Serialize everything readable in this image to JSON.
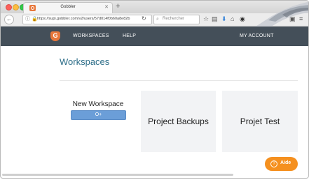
{
  "browser": {
    "tab_title": "Gobbler",
    "url": "https://supi.gobbler.com/v2/users/57d014f0b60a8e82b",
    "search_placeholder": "Rechercher",
    "icons": [
      "back-arrow-icon",
      "forward-arrow-icon",
      "info-icon",
      "lock-icon",
      "reload-icon",
      "search-icon",
      "star-icon",
      "clipboard-icon",
      "download-icon",
      "home-icon",
      "pocket-icon",
      "extension-icon",
      "menu-icon"
    ]
  },
  "app": {
    "logo_letter": "G",
    "nav": {
      "workspaces": "WORKSPACES",
      "help": "HELP",
      "account": "MY ACCOUNT"
    },
    "colors": {
      "header": "#444f59",
      "brand_orange": "#e8773b",
      "title_blue": "#2c6d88",
      "button_blue": "#6b9ed8",
      "help_orange": "#f5901f"
    }
  },
  "main": {
    "title": "Workspaces",
    "new_workspace": {
      "label": "New Workspace",
      "button_icon": "O+"
    },
    "workspaces": [
      {
        "name": "Project Backups"
      },
      {
        "name": "Projet Test"
      }
    ]
  },
  "help_button": {
    "icon": "?",
    "label": "Aide"
  }
}
